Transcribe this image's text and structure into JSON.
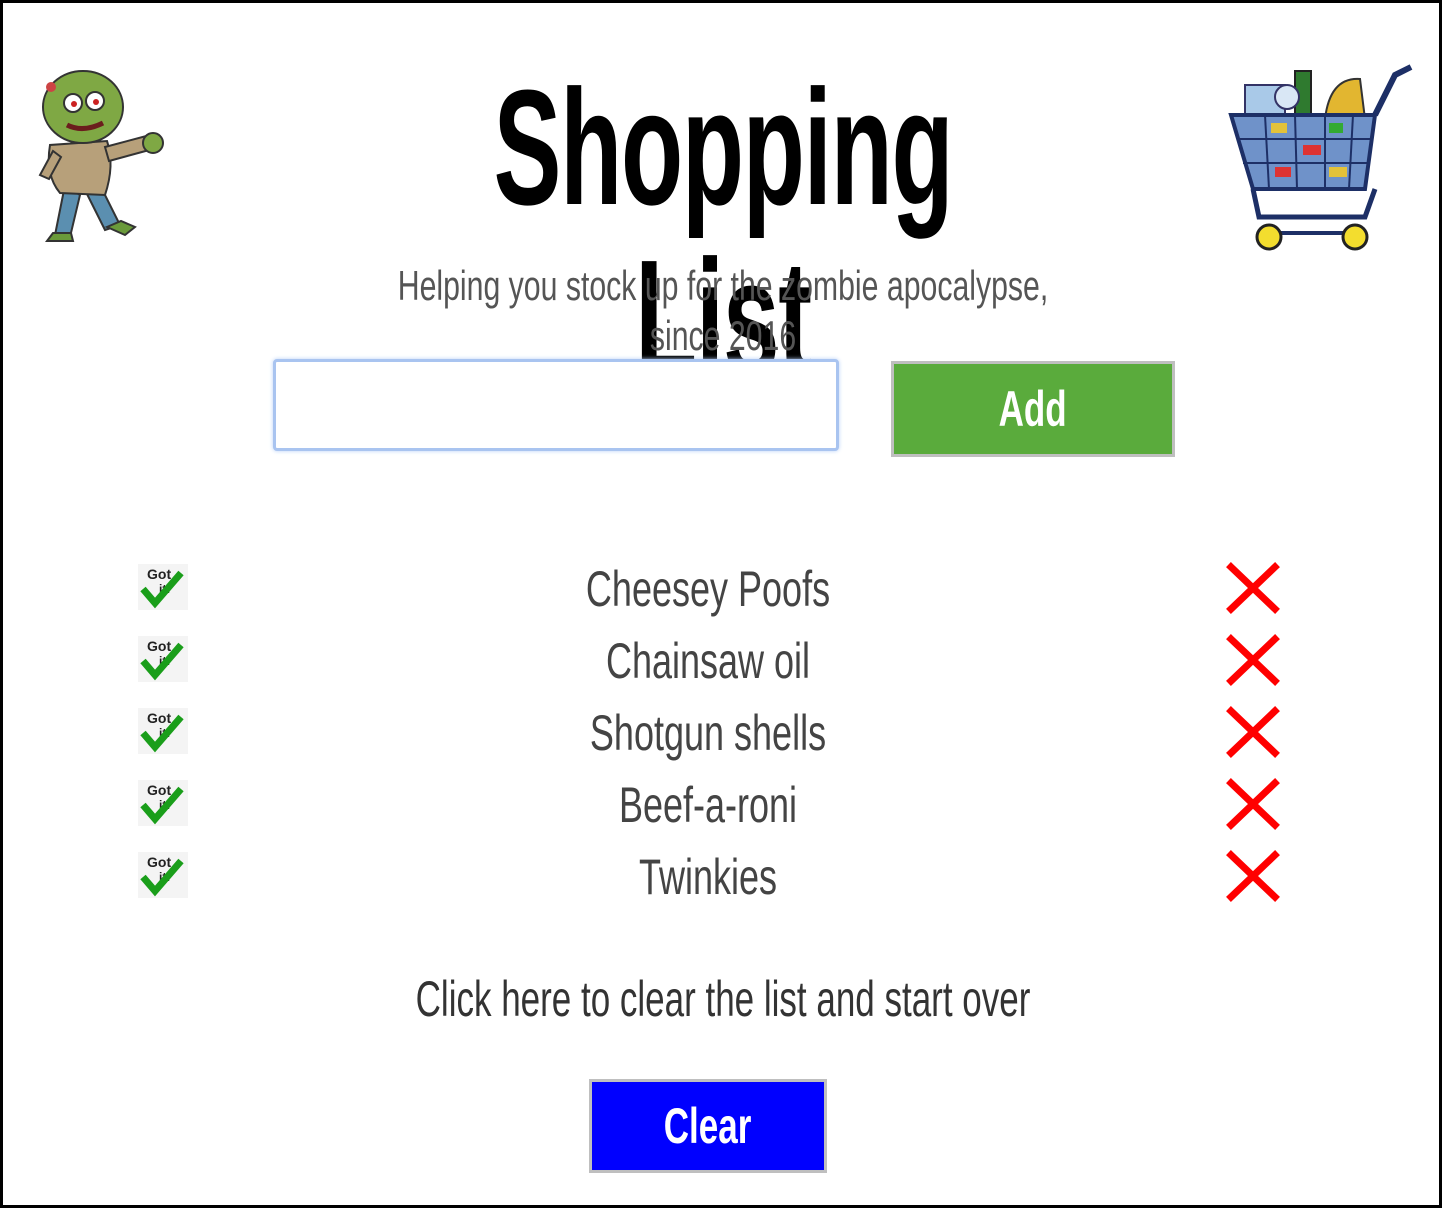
{
  "header": {
    "title": "Shopping List",
    "subtitle": "Helping you stock up for the zombie apocalypse, since 2016",
    "left_image": "zombie-illustration",
    "right_image": "shopping-cart-illustration"
  },
  "entry": {
    "input_value": "",
    "add_label": "Add"
  },
  "list": {
    "items": [
      {
        "label": "Cheesey Poofs",
        "check_icon": "got-it-checkmark-icon",
        "delete_icon": "red-x-icon"
      },
      {
        "label": "Chainsaw oil",
        "check_icon": "got-it-checkmark-icon",
        "delete_icon": "red-x-icon"
      },
      {
        "label": "Shotgun shells",
        "check_icon": "got-it-checkmark-icon",
        "delete_icon": "red-x-icon"
      },
      {
        "label": "Beef-a-roni",
        "check_icon": "got-it-checkmark-icon",
        "delete_icon": "red-x-icon"
      },
      {
        "label": "Twinkies",
        "check_icon": "got-it-checkmark-icon",
        "delete_icon": "red-x-icon"
      }
    ]
  },
  "footer": {
    "clear_note": "Click here to clear the list and start over",
    "clear_label": "Clear"
  },
  "colors": {
    "add_button": "#5aab3c",
    "clear_button": "#0000ff",
    "delete_x": "#ff0000",
    "check_green": "#1a9e1a"
  }
}
